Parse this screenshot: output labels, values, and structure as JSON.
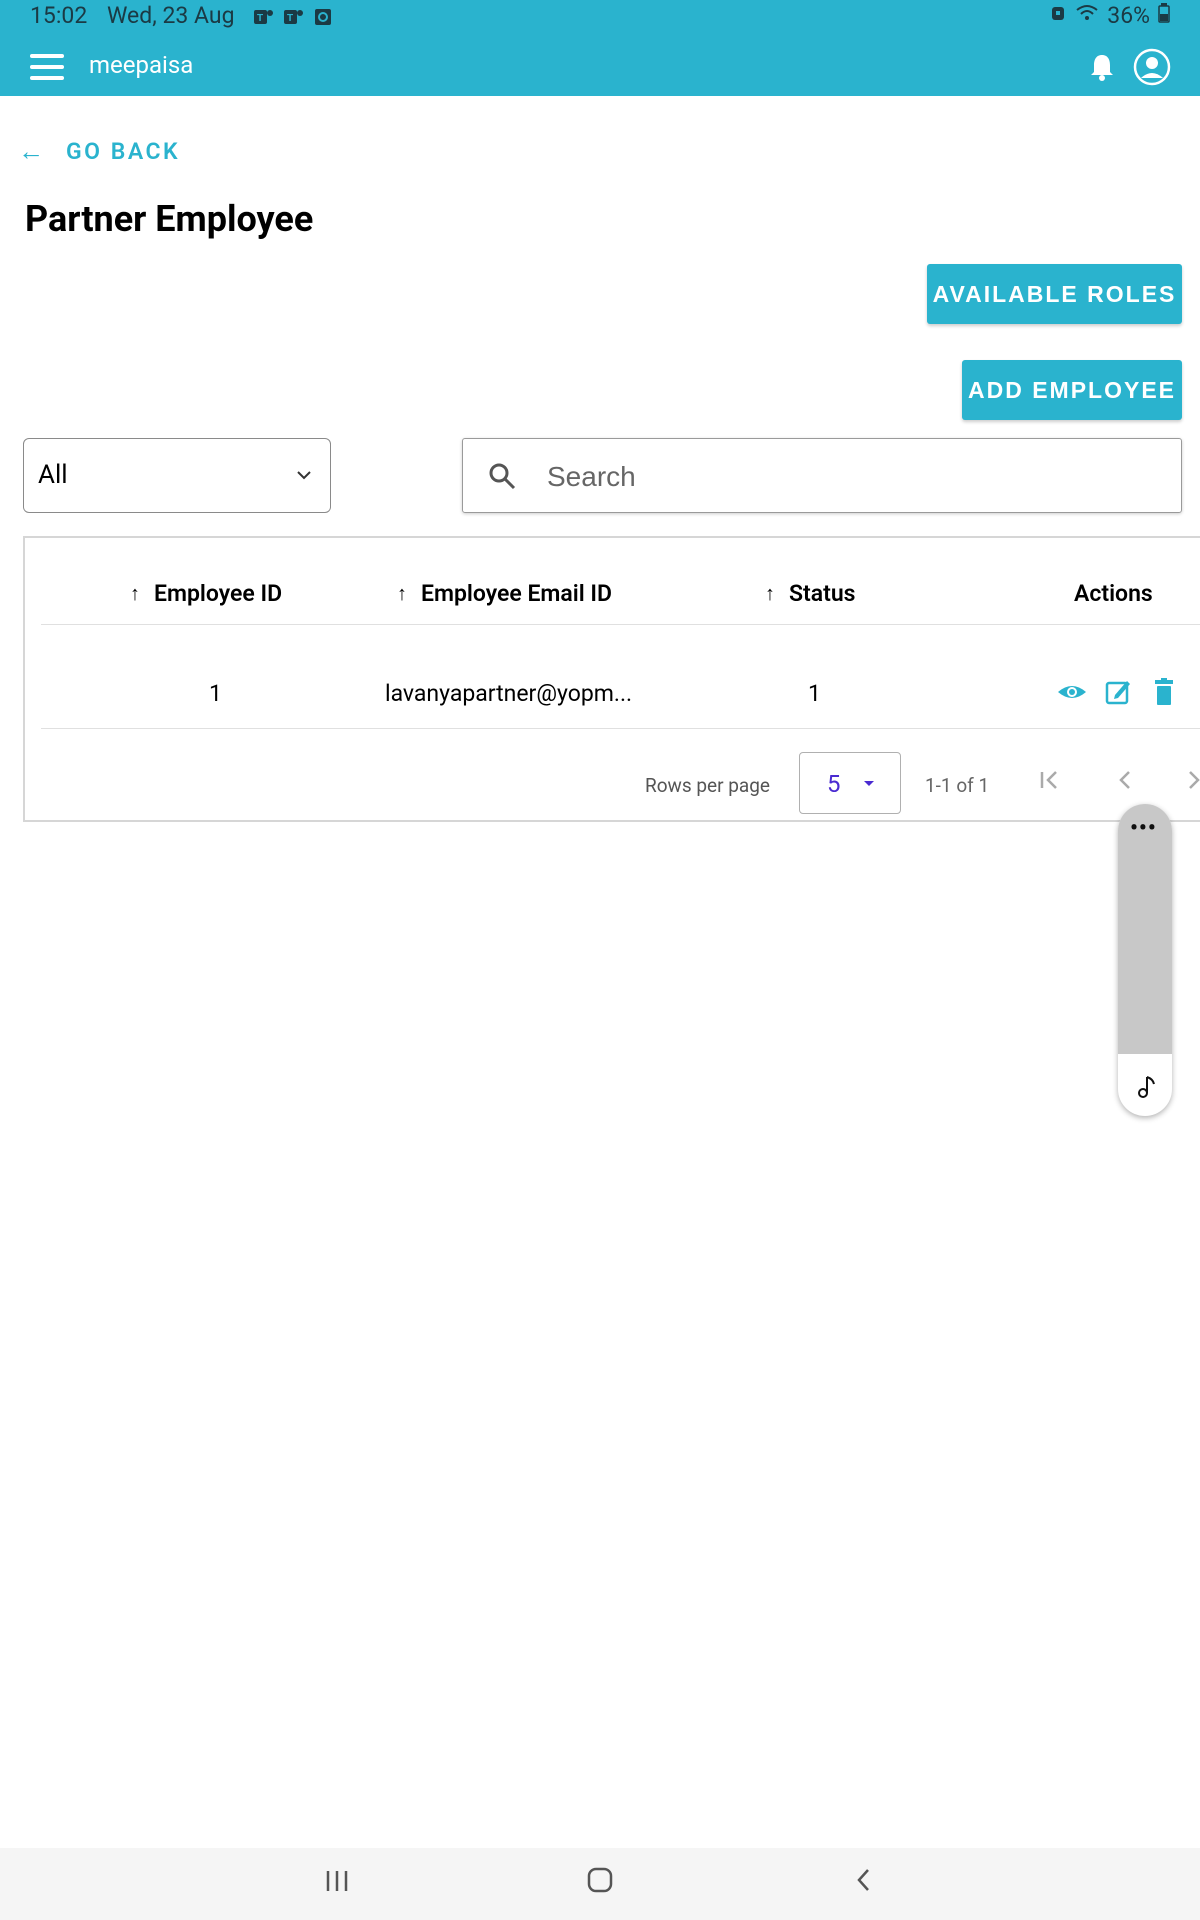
{
  "status_bar": {
    "time": "15:02",
    "date": "Wed, 23 Aug",
    "battery": "36%",
    "left_icons": [
      "teams-icon",
      "teams-icon",
      "outlook-icon"
    ],
    "right_icons": [
      "alarm-icon",
      "wifi-icon",
      "battery-icon"
    ]
  },
  "app_bar": {
    "title": "meepaisa",
    "icons": [
      "menu-icon",
      "bell-icon",
      "account-icon"
    ]
  },
  "go_back": {
    "label": "GO BACK"
  },
  "page": {
    "title": "Partner Employee"
  },
  "buttons": {
    "available_roles": "AVAILABLE ROLES",
    "add_employee": "ADD EMPLOYEE"
  },
  "filter": {
    "selected": "All"
  },
  "search": {
    "placeholder": "Search",
    "value": ""
  },
  "table": {
    "columns": [
      "Employee ID",
      "Employee Email ID",
      "Status",
      "Actions"
    ],
    "rows": [
      {
        "id": "1",
        "email": "lavanyapartner@yopm...",
        "status": "1",
        "actions": [
          "view-icon",
          "edit-icon",
          "delete-icon"
        ]
      }
    ]
  },
  "pagination": {
    "rows_per_page_label": "Rows per page",
    "rows_per_page": "5",
    "range": "1-1 of 1"
  },
  "colors": {
    "accent": "#2AB3CE",
    "select_value": "#4A2BD1"
  }
}
